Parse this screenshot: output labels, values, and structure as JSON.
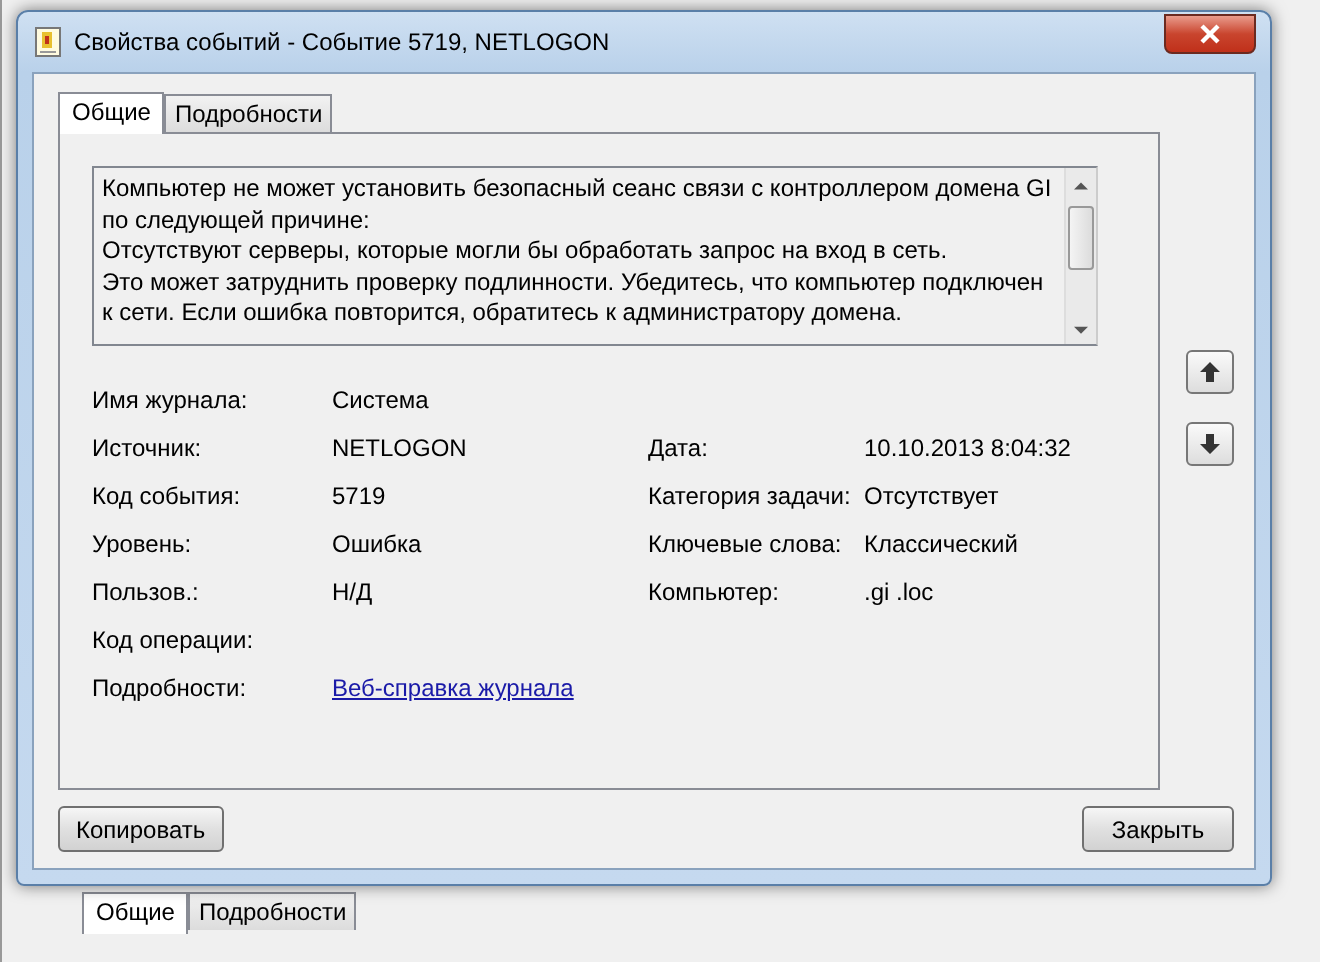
{
  "background_window": {
    "tabs": [
      {
        "label": "Общие",
        "selected": true
      },
      {
        "label": "Подробности",
        "selected": false
      }
    ]
  },
  "window": {
    "title": "Свойства событий - Событие 5719, NETLOGON"
  },
  "tabs": [
    {
      "label": "Общие",
      "selected": true
    },
    {
      "label": "Подробности",
      "selected": false
    }
  ],
  "description": "Компьютер не может установить безопасный сеанс связи с контроллером домена GI\nпо следующей причине:\nОтсутствуют серверы, которые могли бы обработать запрос на вход в сеть.\nЭто может затруднить проверку подлинности. Убедитесь, что компьютер подключен к сети. Если ошибка повторится, обратитесь к администратору домена.",
  "fields": [
    [
      {
        "label": "Имя журнала:",
        "value": "Система",
        "kind": "text"
      }
    ],
    [
      {
        "label": "Источник:",
        "value": "NETLOGON",
        "kind": "text"
      },
      {
        "label": "Дата:",
        "value": "10.10.2013 8:04:32",
        "kind": "text"
      }
    ],
    [
      {
        "label": "Код события:",
        "value": "5719",
        "kind": "text"
      },
      {
        "label": "Категория задачи:",
        "value": "Отсутствует",
        "kind": "text"
      }
    ],
    [
      {
        "label": "Уровень:",
        "value": "Ошибка",
        "kind": "text"
      },
      {
        "label": "Ключевые слова:",
        "value": "Классический",
        "kind": "text"
      }
    ],
    [
      {
        "label": "Пользов.:",
        "value": "Н/Д",
        "kind": "text"
      },
      {
        "label": "Компьютер:",
        "value": ".gi .loc",
        "kind": "text"
      }
    ],
    [
      {
        "label": "Код операции:",
        "kind": "text"
      }
    ],
    [
      {
        "label": "Подробности:",
        "value": "Веб-справка журнала",
        "kind": "link"
      }
    ]
  ],
  "buttons": [
    {
      "label": "Копировать"
    },
    {
      "label": "Закрыть"
    }
  ]
}
